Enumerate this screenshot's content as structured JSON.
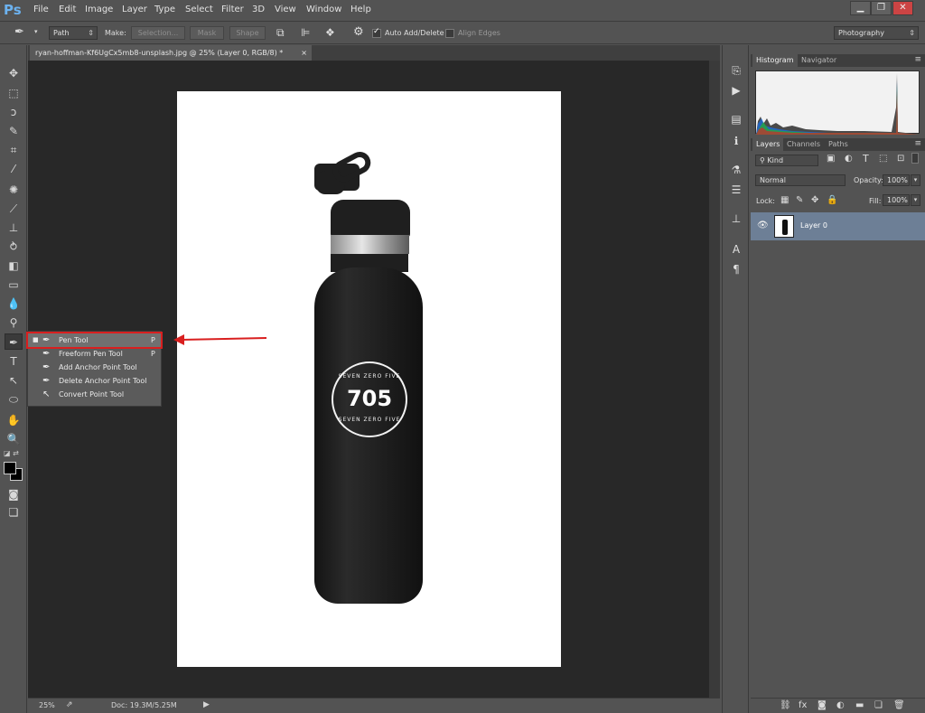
{
  "app": {
    "logo": "Ps",
    "menu": [
      "File",
      "Edit",
      "Image",
      "Layer",
      "Type",
      "Select",
      "Filter",
      "3D",
      "View",
      "Window",
      "Help"
    ],
    "window_controls": [
      "▁",
      "❐",
      "✕"
    ]
  },
  "options_bar": {
    "mode_value": "Path",
    "make_label": "Make:",
    "selection_button": "Selection...",
    "mask_button": "Mask",
    "shape_button": "Shape",
    "auto_add_delete_label": "Auto Add/Delete",
    "auto_add_delete_checked": true,
    "align_edges_label": "Align Edges",
    "align_edges_checked": false,
    "workspace_value": "Photography"
  },
  "document": {
    "tab_title": "ryan-hoffman-Kf6UgCx5mb8-unsplash.jpg @ 25% (Layer 0, RGB/8) *",
    "tab_close": "×",
    "zoom": "25%",
    "doc_size": "Doc: 19.3M/5.25M"
  },
  "bottle": {
    "logo_text_top": "SEVEN ZERO FIVE",
    "logo_number": "705",
    "logo_text_bottom": "SEVEN ZERO FIVE"
  },
  "tool_flyout": {
    "items": [
      {
        "label": "Pen Tool",
        "shortcut": "P",
        "icon": "pen-icon",
        "selected": true
      },
      {
        "label": "Freeform Pen Tool",
        "shortcut": "P",
        "icon": "freeform-pen-icon",
        "selected": false
      },
      {
        "label": "Add Anchor Point Tool",
        "shortcut": "",
        "icon": "add-anchor-icon",
        "selected": false
      },
      {
        "label": "Delete Anchor Point Tool",
        "shortcut": "",
        "icon": "delete-anchor-icon",
        "selected": false
      },
      {
        "label": "Convert Point Tool",
        "shortcut": "",
        "icon": "convert-point-icon",
        "selected": false
      }
    ]
  },
  "panels": {
    "histogram_tabs": [
      "Histogram",
      "Navigator"
    ],
    "layers_tabs": [
      "Layers",
      "Channels",
      "Paths"
    ],
    "kind_filter": "Kind",
    "blend_mode": "Normal",
    "opacity_label": "Opacity:",
    "opacity_value": "100%",
    "lock_label": "Lock:",
    "fill_label": "Fill:",
    "fill_value": "100%",
    "layer_name": "Layer 0"
  },
  "colors": {
    "accent_red": "#d91f1f",
    "selected_layer": "#6d7f96",
    "ps_blue": "#6cb2f0"
  }
}
